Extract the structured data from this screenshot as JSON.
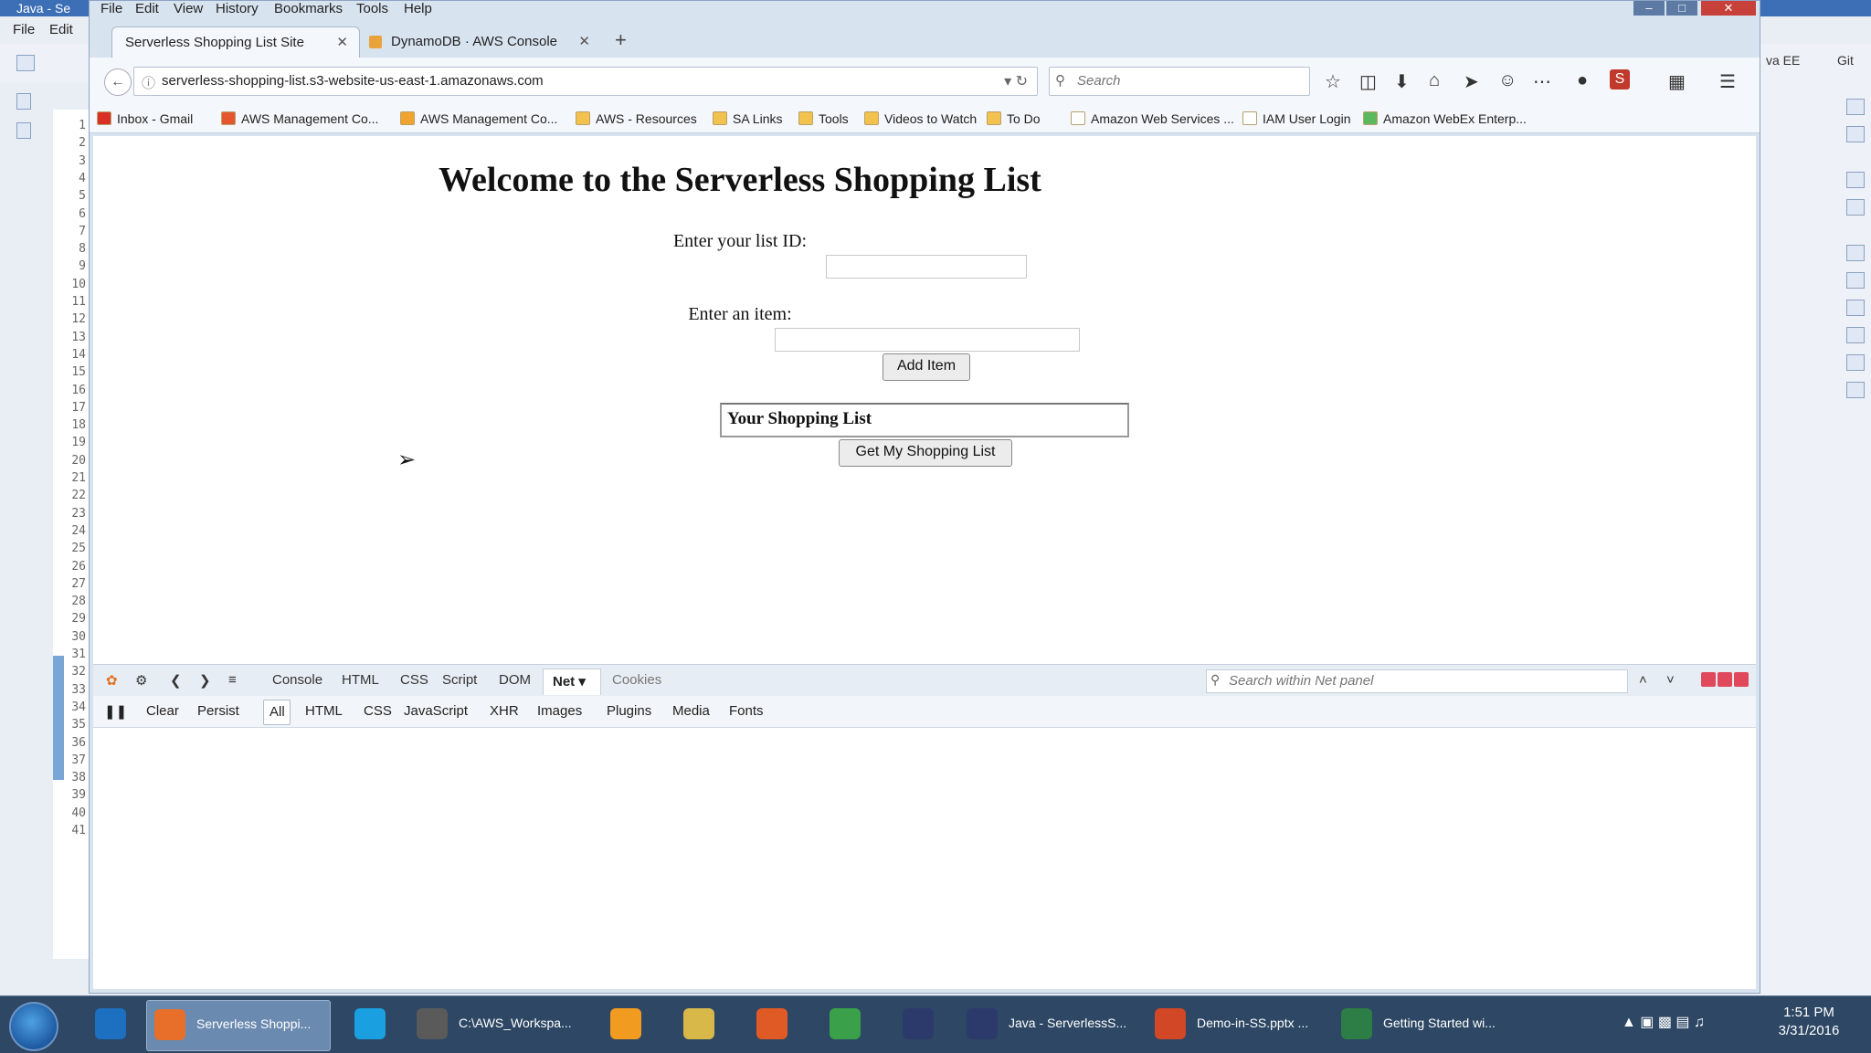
{
  "ide": {
    "title": "Java - Se",
    "menu": [
      "File",
      "Edit"
    ],
    "line_numbers": [
      "1",
      "2",
      "3",
      "4",
      "5",
      "6",
      "7",
      "8",
      "9",
      "10",
      "11",
      "12",
      "13",
      "14",
      "15",
      "16",
      "17",
      "18",
      "19",
      "20",
      "21",
      "22",
      "23",
      "24",
      "25",
      "26",
      "27",
      "28",
      "29",
      "30",
      "31",
      "32",
      "33",
      "34",
      "35",
      "36",
      "37",
      "38",
      "39",
      "40",
      "41"
    ],
    "right_labels": [
      "va EE",
      "Git"
    ]
  },
  "browser": {
    "menu": [
      "File",
      "Edit",
      "View",
      "History",
      "Bookmarks",
      "Tools",
      "Help"
    ],
    "tabs": [
      {
        "label": "Serverless Shopping List Site",
        "active": true
      },
      {
        "label": "DynamoDB · AWS Console",
        "active": false
      }
    ],
    "new_tab": "+",
    "url": "serverless-shopping-list.s3-website-us-east-1.amazonaws.com",
    "search_placeholder": "Search",
    "bookmarks": [
      {
        "label": "Inbox - Gmail",
        "color": "#d93025"
      },
      {
        "label": "AWS Management Co...",
        "color": "#e4572e"
      },
      {
        "label": "AWS Management Co...",
        "color": "#f0a32f"
      },
      {
        "label": "AWS - Resources",
        "color": "#f2c14e"
      },
      {
        "label": "SA Links",
        "color": "#f2c14e"
      },
      {
        "label": "Tools",
        "color": "#f2c14e"
      },
      {
        "label": "Videos to Watch",
        "color": "#f2c14e"
      },
      {
        "label": "To Do",
        "color": "#f2c14e"
      },
      {
        "label": "Amazon Web Services ...",
        "color": "#ffffff"
      },
      {
        "label": "IAM User Login",
        "color": "#ffffff"
      },
      {
        "label": "Amazon WebEx Enterp...",
        "color": "#5cb85c"
      }
    ]
  },
  "page": {
    "title": "Welcome to the Serverless Shopping List",
    "list_id_label": "Enter your list ID:",
    "item_label": "Enter an item:",
    "add_item_button": "Add Item",
    "shopping_list_header": "Your Shopping List",
    "get_list_button": "Get My Shopping List"
  },
  "firebug": {
    "tabs": [
      "Console",
      "HTML",
      "CSS",
      "Script",
      "DOM",
      "Net ▾",
      "Cookies"
    ],
    "search_placeholder": "Search within Net panel",
    "net_toolbar": [
      "Clear",
      "Persist",
      "All",
      "HTML",
      "CSS",
      "JavaScript",
      "XHR",
      "Images",
      "Plugins",
      "Media",
      "Fonts"
    ]
  },
  "taskbar": {
    "items": [
      {
        "label": "",
        "color": "#1d6fc0",
        "active": false
      },
      {
        "label": "Serverless Shoppi...",
        "color": "#e76f2a",
        "active": true
      },
      {
        "label": "",
        "color": "#1aa0e0",
        "active": false
      },
      {
        "label": "C:\\AWS_Workspa...",
        "color": "#5a5a5a",
        "active": false
      },
      {
        "label": "",
        "color": "#f29b21",
        "active": false
      },
      {
        "label": "",
        "color": "#d9b84a",
        "active": false
      },
      {
        "label": "",
        "color": "#e05a26",
        "active": false
      },
      {
        "label": "",
        "color": "#3aa04a",
        "active": false
      },
      {
        "label": "",
        "color": "#2b3a6b",
        "active": false
      },
      {
        "label": "Java - ServerlessS...",
        "color": "#2b3a6b",
        "active": false
      },
      {
        "label": "Demo-in-SS.pptx ...",
        "color": "#d24726",
        "active": false
      },
      {
        "label": "Getting Started wi...",
        "color": "#2d7d46",
        "active": false
      }
    ],
    "time": "1:51 PM",
    "date": "3/31/2016"
  }
}
